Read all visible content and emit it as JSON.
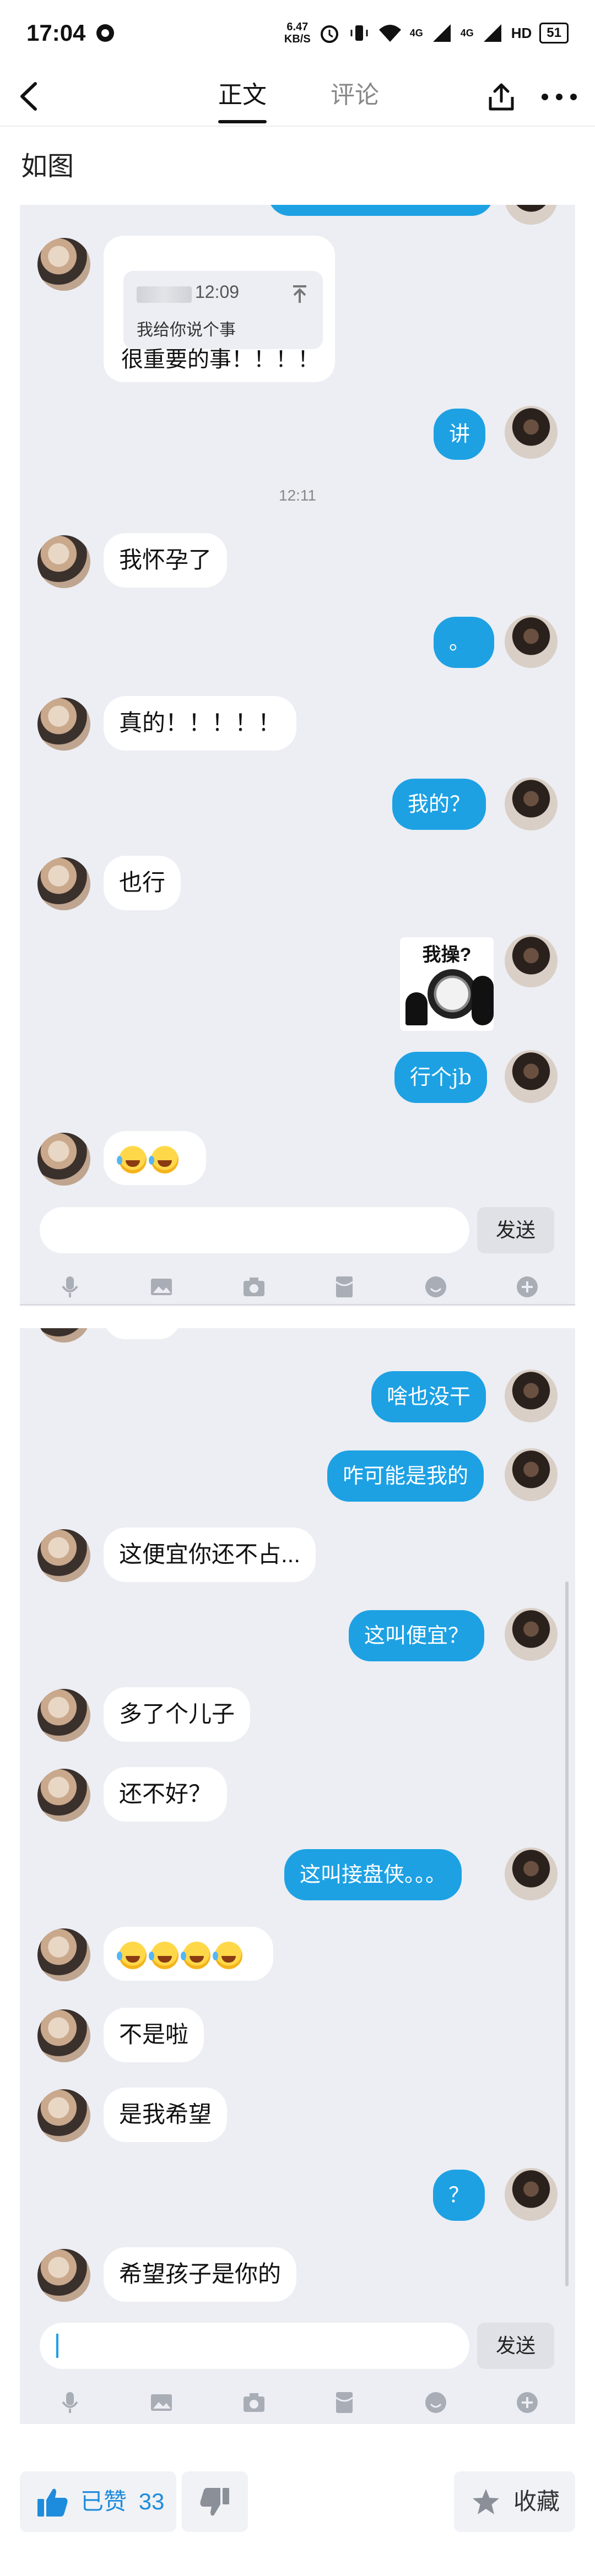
{
  "status_bar": {
    "time": "17:04",
    "net_speed_value": "6.47",
    "net_speed_unit": "KB/S",
    "signal_1": "4G",
    "signal_2": "4G",
    "hd": "HD",
    "battery": "51"
  },
  "nav": {
    "tab_main": "正文",
    "tab_comments": "评论"
  },
  "post": {
    "title": "如图"
  },
  "panel1": {
    "quote_time": "12:09",
    "quote_text": "我给你说个事",
    "msg_important": "很重要的事！！！！",
    "msg_jiang": "讲",
    "timestamp": "12:11",
    "msg_pregnant": "我怀孕了",
    "msg_period": "。",
    "msg_really": "真的！！！！！",
    "msg_mine": "我的？",
    "msg_ok": "也行",
    "sticker_text": "我操?",
    "msg_xing": "行个jb",
    "send_label": "发送"
  },
  "panel2": {
    "msg_nothing": "啥也没干",
    "msg_impossible": "咋可能是我的",
    "msg_cheap": "这便宜你还不占...",
    "msg_cheap_q": "这叫便宜？",
    "msg_son": "多了个儿子",
    "msg_not_good": "还不好？",
    "msg_takeover": "这叫接盘侠。。。",
    "msg_not": "不是啦",
    "msg_hope": "是我希望",
    "msg_question": "？",
    "msg_hope_child": "希望孩子是你的",
    "send_label": "发送"
  },
  "bottom_bar": {
    "liked_label": "已赞",
    "like_count": "33",
    "fav_label": "收藏"
  },
  "colors": {
    "bubble_blue": "#1da1e3",
    "like_blue": "#1e8cdc",
    "panel_bg": "#eceef3"
  }
}
